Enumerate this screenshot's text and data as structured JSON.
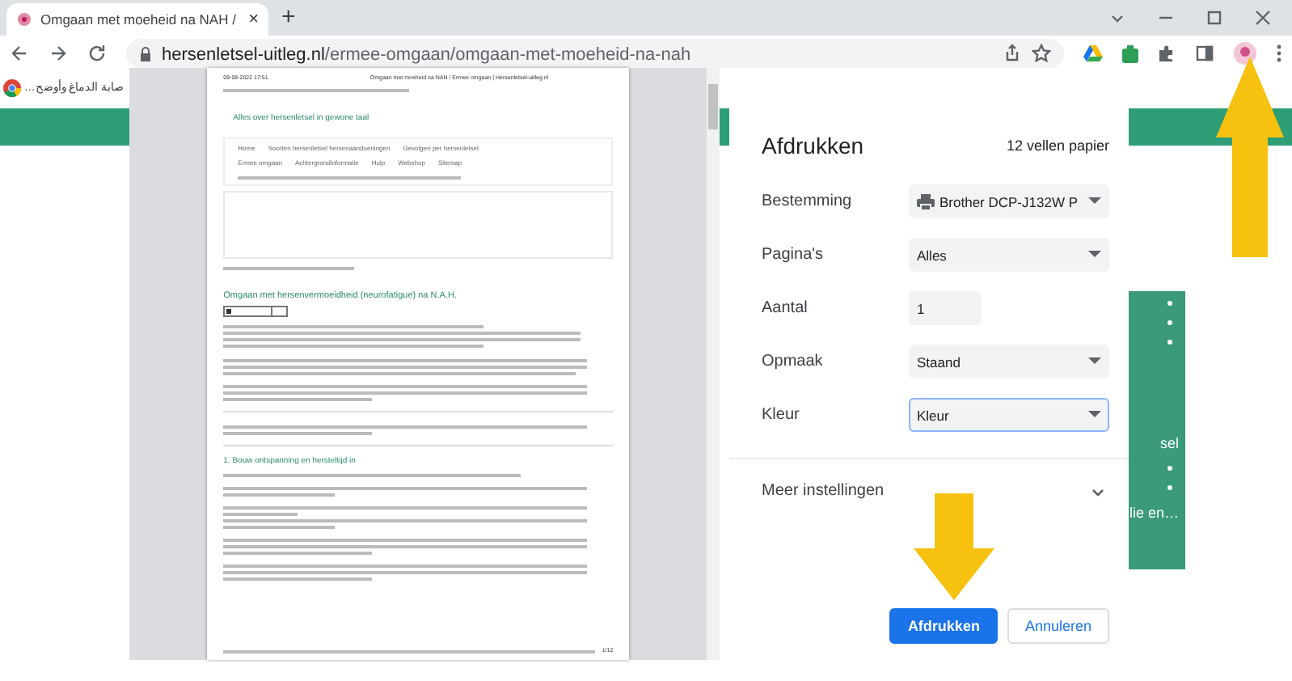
{
  "browser": {
    "tab": {
      "title": "Omgaan met moeheid na NAH /",
      "close": "×"
    },
    "new_tab": "+",
    "url": {
      "domain": "hersenletsel-uitleg.nl",
      "path": "/ermee-omgaan/omgaan-met-moeheid-na-nah"
    },
    "bookmark": "صابة الدماغ وأوضح…"
  },
  "page_behind": {
    "side_texts": [
      "sel",
      "lie en…"
    ]
  },
  "preview": {
    "header_date": "09-08-2022 17:51",
    "header_title": "Omgaan met moeheid na NAH / Ermee omgaan | Hersenletsel-uitleg.nl",
    "tagline": "Alles over hersenletsel in gewone taal",
    "nav_rows": [
      [
        "Home",
        "Soorten hersenletsel hersenaandoeningen",
        "Gevolgen per hersenletsel"
      ],
      [
        "Ermee omgaan",
        "Achtergrondinformatie",
        "Hulp",
        "Webshop",
        "Sitemap"
      ]
    ],
    "article_title": "Omgaan met hersenvermoeidheid (neurofatigue) na N.A.H.",
    "section_title": "1. Bouw ontspanning en hersteltijd in",
    "page_number": "1/12"
  },
  "print_dialog": {
    "title": "Afdrukken",
    "sheets": "12 vellen papier",
    "settings": [
      {
        "label": "Bestemming",
        "kind": "select",
        "value": "Brother DCP-J132W P",
        "focused": false
      },
      {
        "label": "Pagina's",
        "kind": "select",
        "value": "Alles",
        "focused": false
      },
      {
        "label": "Aantal",
        "kind": "input",
        "value": "1",
        "focused": false
      },
      {
        "label": "Opmaak",
        "kind": "select",
        "value": "Staand",
        "focused": false
      },
      {
        "label": "Kleur",
        "kind": "select",
        "value": "Kleur",
        "focused": true
      }
    ],
    "more_settings": {
      "label": "Meer instellingen",
      "expanded": false
    },
    "buttons": [
      {
        "label": "Afdrukken",
        "kind": "primary"
      },
      {
        "label": "Annuleren",
        "kind": "secondary"
      }
    ]
  }
}
